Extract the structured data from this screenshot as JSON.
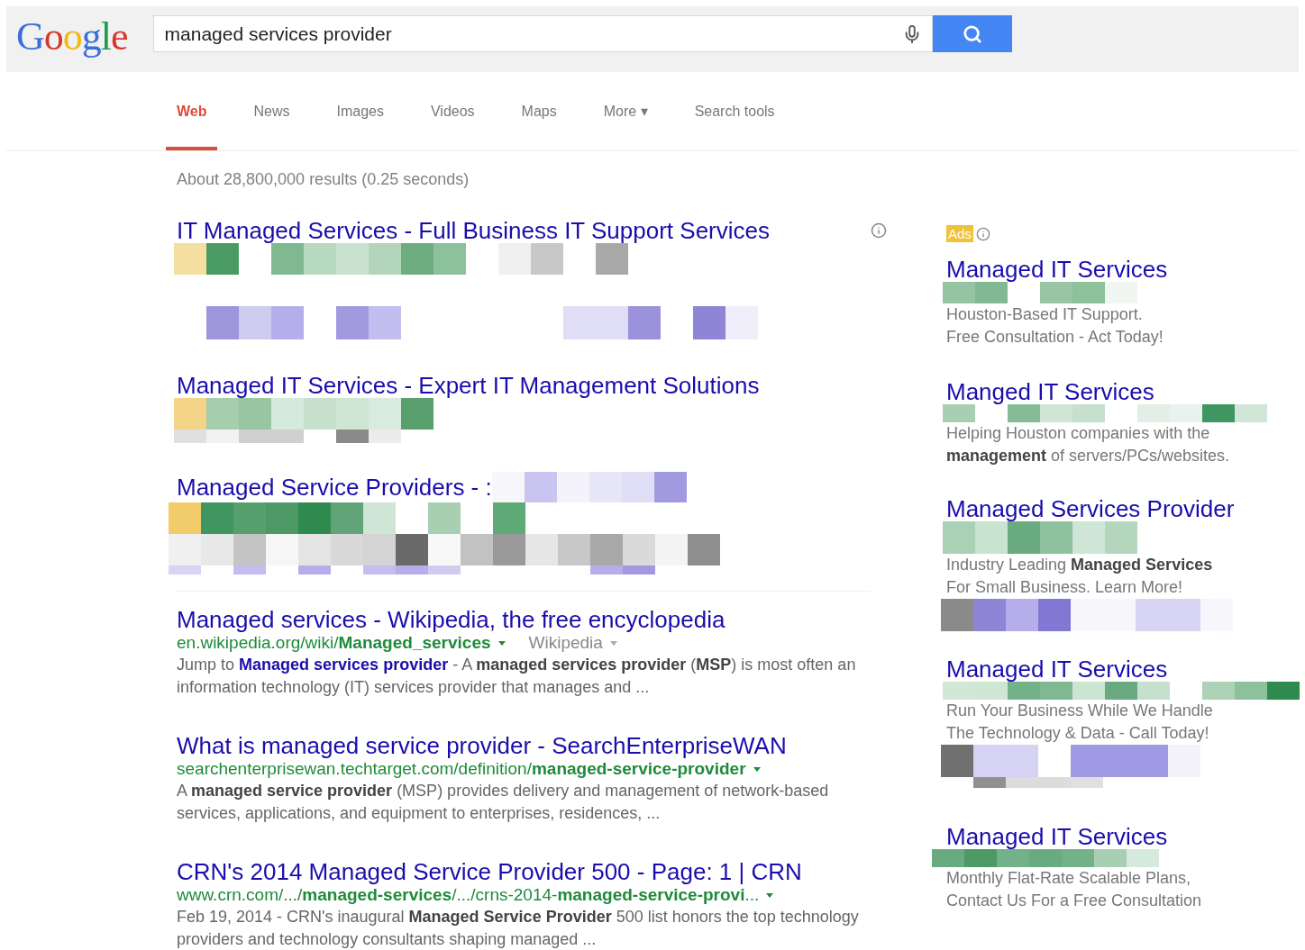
{
  "logo": "Google",
  "search": {
    "value": "managed services provider"
  },
  "tabs": [
    {
      "label": "Web",
      "selected": true
    },
    {
      "label": "News",
      "selected": false
    },
    {
      "label": "Images",
      "selected": false
    },
    {
      "label": "Videos",
      "selected": false
    },
    {
      "label": "Maps",
      "selected": false
    },
    {
      "label": "More ▾",
      "selected": false
    },
    {
      "label": "Search tools",
      "selected": false
    }
  ],
  "result_stats": "About 28,800,000 results (0.25 seconds)",
  "results": [
    {
      "kind": "redacted",
      "title": "IT Managed Services - Full Business IT Support Services",
      "info": true
    },
    {
      "kind": "redacted",
      "title": "Managed IT Services - Expert IT Management Solutions",
      "info": false
    },
    {
      "kind": "redacted",
      "title": "Managed Service Providers - :",
      "info": false
    },
    {
      "kind": "full",
      "title": "Managed services - Wikipedia, the free encyclopedia",
      "url": "en.wikipedia.org/wiki/**Managed_services**",
      "source": "Wikipedia",
      "jump_prefix": "Jump to",
      "jump_link": "Managed services provider",
      "snippet": " - A **managed services provider** (**MSP**) is most often an information technology (IT) services provider that manages and ..."
    },
    {
      "kind": "full",
      "title": "What is managed service provider - SearchEnterpriseWAN",
      "url": "searchenterprisewan.techtarget.com/definition/**managed-service-provider**",
      "snippet": "A **managed service provider** (MSP) provides delivery and management of network-based services, applications, and equipment to enterprises, residences, ..."
    },
    {
      "kind": "full",
      "title": "CRN's 2014 Managed Service Provider 500 - Page: 1 | CRN",
      "url": "www.crn.com/.../**managed-services**/.../crns-2014-**managed-service-provi**...",
      "snippet": "Feb 19, 2014 - CRN's inaugural **Managed Service Provider** 500 list honors the top technology providers and technology consultants shaping managed ..."
    }
  ],
  "ads_label": "Ads",
  "ads": [
    {
      "title": "Managed IT Services",
      "lines": [
        "Houston-Based IT Support.",
        "Free Consultation - Act Today!"
      ]
    },
    {
      "title": "Manged IT Services",
      "lines": [
        "Helping Houston companies with the",
        "**management** of servers/PCs/websites."
      ]
    },
    {
      "title": "Managed Services Provider",
      "lines": [
        "Industry Leading **Managed Services**",
        "For Small Business. Learn More!"
      ]
    },
    {
      "title": "Managed IT Services",
      "lines": [
        "Run Your Business While We Handle",
        "The Technology & Data - Call Today!"
      ]
    },
    {
      "title": "Managed IT Services",
      "lines": [
        "Monthly Flat-Rate Scalable Plans,",
        "Contact Us For a Free Consultation"
      ]
    }
  ]
}
